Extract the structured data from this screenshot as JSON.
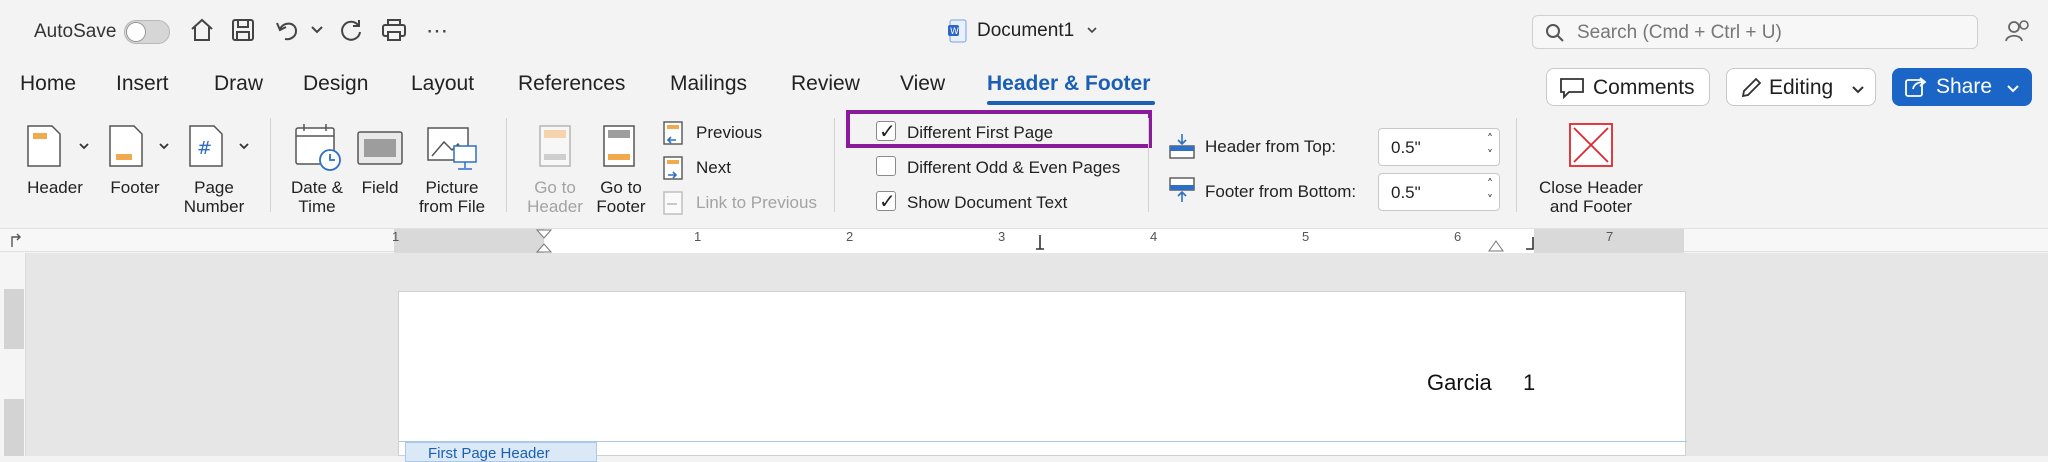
{
  "titlebar": {
    "autosave_label": "AutoSave",
    "document_title": "Document1",
    "search_placeholder": "Search (Cmd + Ctrl + U)"
  },
  "tabs": [
    {
      "label": "Home"
    },
    {
      "label": "Insert"
    },
    {
      "label": "Draw"
    },
    {
      "label": "Design"
    },
    {
      "label": "Layout"
    },
    {
      "label": "References"
    },
    {
      "label": "Mailings"
    },
    {
      "label": "Review"
    },
    {
      "label": "View"
    },
    {
      "label": "Header & Footer",
      "active": true
    }
  ],
  "actions": {
    "comments_label": "Comments",
    "editing_label": "Editing",
    "share_label": "Share"
  },
  "ribbon": {
    "header_label": "Header",
    "footer_label": "Footer",
    "page_number_label_1": "Page",
    "page_number_label_2": "Number",
    "date_time_label_1": "Date &",
    "date_time_label_2": "Time",
    "field_label": "Field",
    "picture_label_1": "Picture",
    "picture_label_2": "from File",
    "go_to_header_label_1": "Go to",
    "go_to_header_label_2": "Header",
    "go_to_footer_label_1": "Go to",
    "go_to_footer_label_2": "Footer",
    "previous_label": "Previous",
    "next_label": "Next",
    "link_to_previous_label": "Link to Previous",
    "options": [
      {
        "label": "Different First Page",
        "checked": true
      },
      {
        "label": "Different Odd & Even Pages",
        "checked": false
      },
      {
        "label": "Show Document Text",
        "checked": true
      }
    ],
    "header_from_top_label": "Header from Top:",
    "header_from_top_value": "0.5\"",
    "footer_from_bottom_label": "Footer from Bottom:",
    "footer_from_bottom_value": "0.5\"",
    "close_label_1": "Close Header",
    "close_label_2": "and Footer"
  },
  "ruler": {
    "numbers": [
      "1",
      "1",
      "2",
      "3",
      "4",
      "5",
      "6",
      "7"
    ]
  },
  "document": {
    "header_name": "Garcia",
    "header_page_number": "1",
    "header_tag": "First Page Header"
  },
  "colors": {
    "accent": "#1b5fb4",
    "share_button": "#1b65c7",
    "highlight_box": "#8a1c9c",
    "close_icon": "#e0262c"
  }
}
